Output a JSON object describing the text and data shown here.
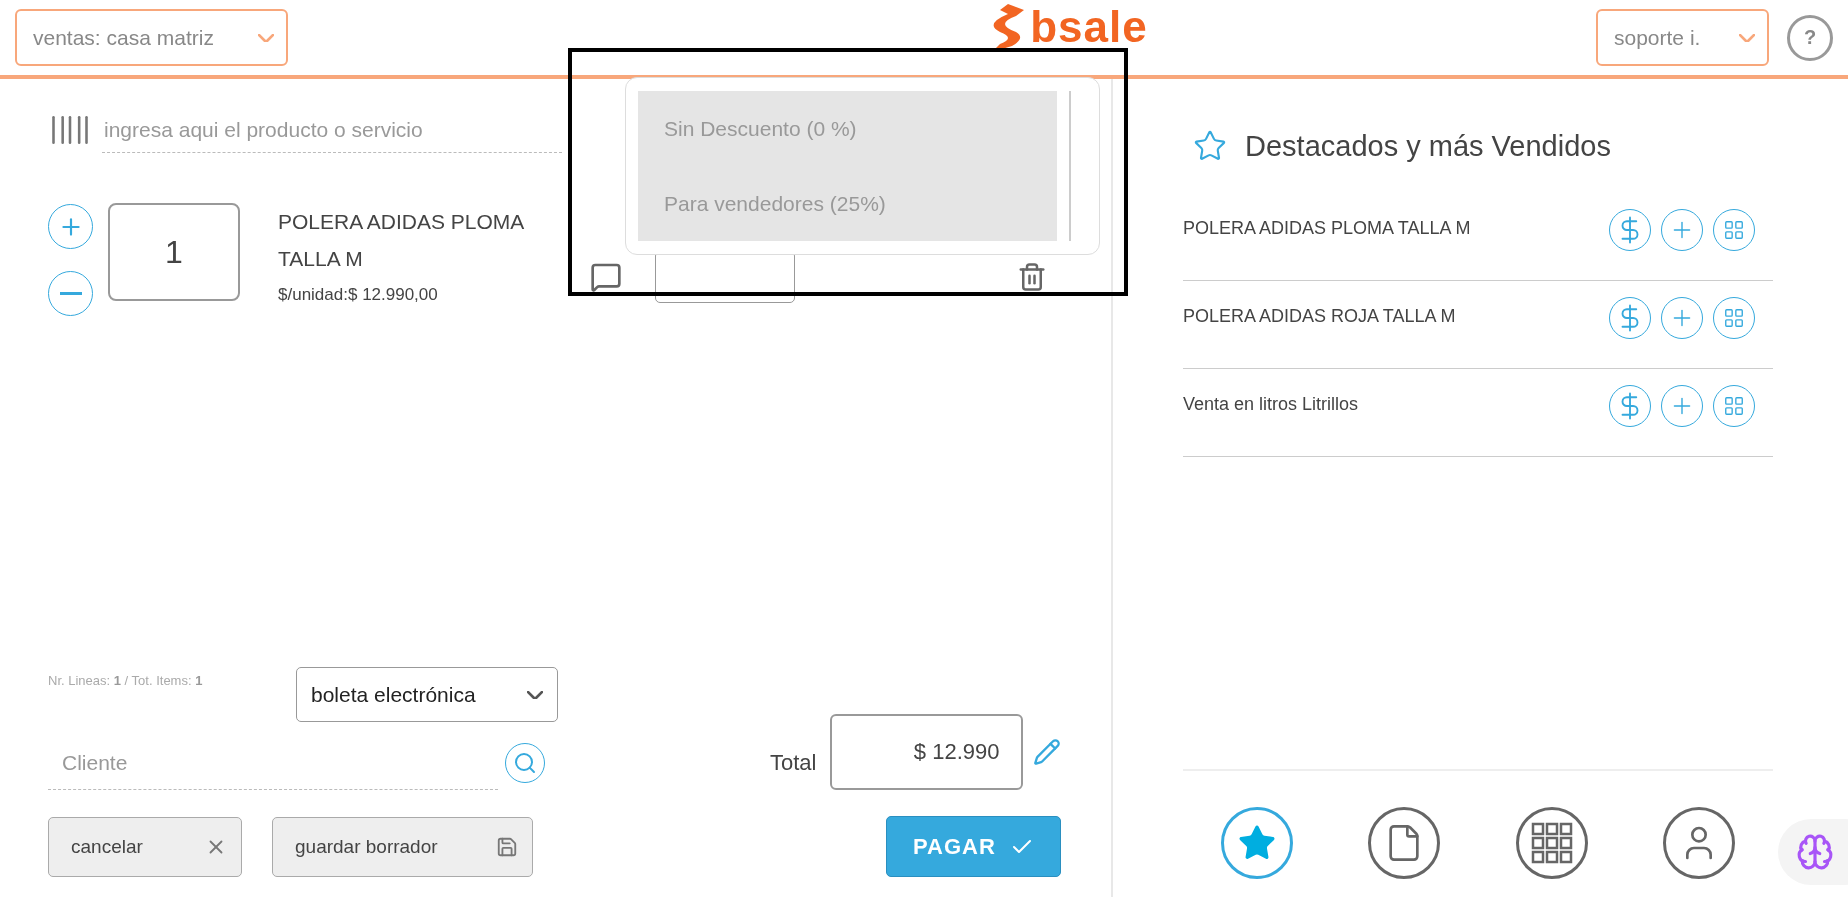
{
  "header": {
    "branch_select": "ventas: casa matriz",
    "logo": "bsale",
    "user_select": "soporte i.",
    "help": "?"
  },
  "scanner": {
    "placeholder": "ingresa aqui el producto o servicio"
  },
  "cart": [
    {
      "quantity": "1",
      "name": "POLERA ADIDAS PLOMA TALLA M",
      "unit_price": "$/unidad:$ 12.990,00"
    }
  ],
  "discount_menu": {
    "options": [
      {
        "label": "Sin Descuento (0 %)"
      },
      {
        "label": "Para vendedores (25%)"
      }
    ]
  },
  "summary": "Nr. Lineas: **1** / Tot. Items: **1**",
  "document_type": "boleta electrónica",
  "client": {
    "placeholder": "Cliente"
  },
  "total": {
    "label": "Total",
    "value": "$ 12.990"
  },
  "actions": {
    "cancel": "cancelar",
    "draft": "guardar borrador",
    "pay": "PAGAR"
  },
  "featured": {
    "title": "Destacados y más Vendidos",
    "items": [
      {
        "name": "POLERA ADIDAS PLOMA TALLA M"
      },
      {
        "name": "POLERA ADIDAS ROJA TALLA M"
      },
      {
        "name": "Venta en litros Litrillos"
      }
    ]
  },
  "nav": [
    {
      "kind": "featured",
      "selected": true
    },
    {
      "kind": "documents",
      "selected": false
    },
    {
      "kind": "catalog",
      "selected": false
    },
    {
      "kind": "client",
      "selected": false
    }
  ]
}
